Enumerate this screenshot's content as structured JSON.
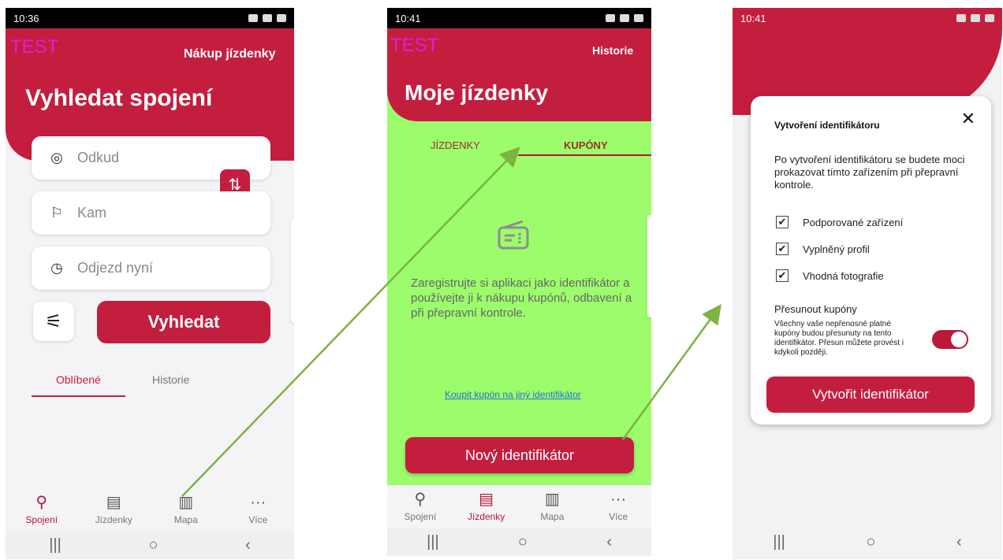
{
  "screen1": {
    "status_time": "10:36",
    "test_label": "TEST",
    "header_link": "Nákup jízdenky",
    "title": "Vyhledat spojení",
    "from_placeholder": "Odkud",
    "to_placeholder": "Kam",
    "departure": "Odjezd nyní",
    "search_button": "Vyhledat",
    "tabs": [
      "Oblíbené",
      "Historie"
    ],
    "nav": [
      "Spojení",
      "Jízdenky",
      "Mapa",
      "Více"
    ],
    "active_nav": "Spojení"
  },
  "screen2": {
    "status_time": "10:41",
    "test_label": "TEST",
    "header_link": "Historie",
    "title": "Moje jízdenky",
    "tabs": [
      "JÍZDENKY",
      "KUPÓNY"
    ],
    "active_tab": "KUPÓNY",
    "info_text": "Zaregistrujte si aplikaci jako identifikátor a používejte ji k nákupu kupónů, odbavení a při přepravní kontrole.",
    "link_text": "Koupit kupón na jiný identifikátor",
    "button": "Nový identifikátor",
    "nav": [
      "Spojení",
      "Jízdenky",
      "Mapa",
      "Více"
    ],
    "active_nav": "Jízdenky"
  },
  "screen3": {
    "status_time": "10:41",
    "modal": {
      "title": "Vytvoření identifikátoru",
      "close": "✕",
      "description": "Po vytvoření identifikátoru se budete moci prokazovat tímto zařízením při přepravní kontrole.",
      "checks": [
        "Podporované zařízení",
        "Vyplněný profil",
        "Vhodná fotografie"
      ],
      "move_title": "Přesunout kupóny",
      "move_text": "Všechny vaše nepřenosné platné kupóny budou přesunuty na tento identifikátor. Přesun můžete provést i kdykoli později.",
      "toggle_on": true,
      "button": "Vytvořit identifikátor"
    }
  },
  "colors": {
    "brand": "#c41e3f",
    "green_highlight": "#9cfc6c",
    "arrow": "#7cb342",
    "test_label": "#e61bd8"
  }
}
